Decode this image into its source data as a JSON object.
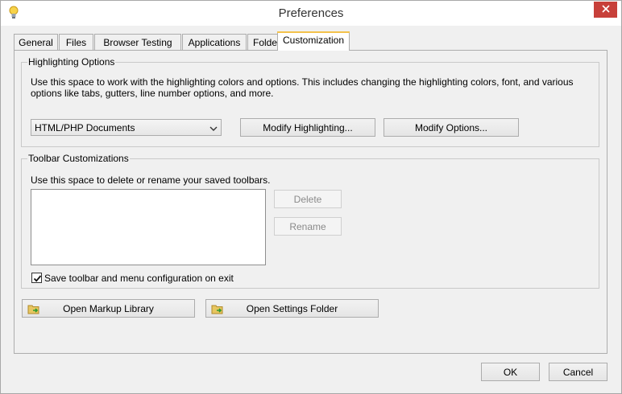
{
  "window": {
    "title": "Preferences"
  },
  "tabs": [
    {
      "label": "General"
    },
    {
      "label": "Files"
    },
    {
      "label": "Browser Testing"
    },
    {
      "label": "Applications"
    },
    {
      "label": "Folders"
    },
    {
      "label": "Customization",
      "active": true
    }
  ],
  "highlighting": {
    "legend": "Highlighting Options",
    "description": "Use this space to work with the highlighting colors and options. This includes changing the highlighting colors, font, and various options like tabs, gutters, line number options, and more.",
    "document_type": "HTML/PHP Documents",
    "modify_highlighting_label": "Modify Highlighting...",
    "modify_options_label": "Modify Options..."
  },
  "toolbar": {
    "legend": "Toolbar Customizations",
    "description": "Use this space to delete or rename your saved toolbars.",
    "saved_toolbars": [],
    "delete_label": "Delete",
    "rename_label": "Rename",
    "save_on_exit_label": "Save toolbar and menu configuration on exit",
    "save_on_exit_checked": true
  },
  "actions": {
    "open_markup_library_label": "Open Markup Library",
    "open_settings_folder_label": "Open Settings Folder"
  },
  "dialog": {
    "ok_label": "OK",
    "cancel_label": "Cancel"
  },
  "colors": {
    "close_button": "#c7403a",
    "active_tab_accent": "#f3c24b"
  },
  "icons": {
    "app": "lightbulb-icon",
    "close": "close-icon",
    "folder": "folder-arrow-icon"
  }
}
